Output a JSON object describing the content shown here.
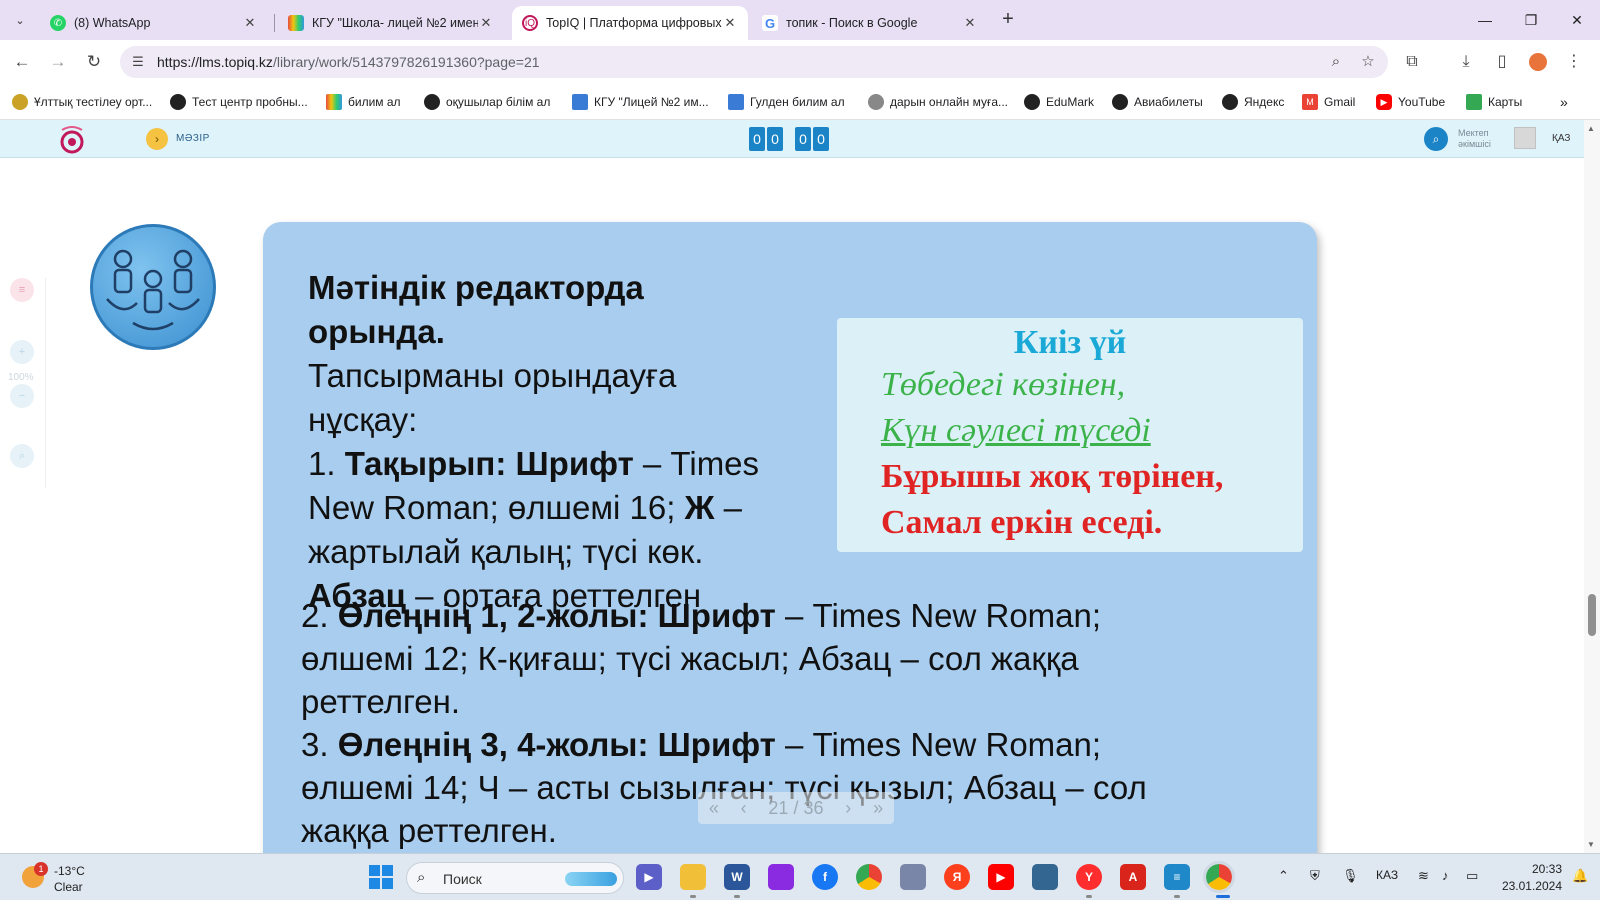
{
  "browser": {
    "tabs": [
      {
        "label": "(8) WhatsApp",
        "active": false
      },
      {
        "label": "КГУ \"Школа- лицей №2 имени",
        "active": false
      },
      {
        "label": "TopIQ | Платформа цифровых",
        "active": true
      },
      {
        "label": "топик - Поиск в Google",
        "active": false
      }
    ],
    "url_host": "https://lms.topiq.kz",
    "url_path": "/library/work/5143797826191360?page=21",
    "bookmarks": [
      "Ұлттық тестілеу орт...",
      "Тест центр пробны...",
      "билим ал",
      "оқушылар білім ал",
      "КГУ \"Лицей №2 им...",
      "Гулден билим ал",
      "дарын онлайн муға...",
      "EduMark",
      "Авиабилеты",
      "Яндекс",
      "Gmail",
      "YouTube",
      "Карты"
    ]
  },
  "site": {
    "menu_label": "МӘЗІР",
    "timer": [
      "0",
      "0",
      "0",
      "0"
    ],
    "role_line1": "Мектеп",
    "role_line2": "әкімшісі",
    "language": "ҚАЗ",
    "zoom": "100%"
  },
  "card": {
    "title_line1": "Мәтіндік редакторда",
    "title_line2": "орында.",
    "intro_line1": "Тапсырманы орындауға",
    "intro_line2": "нұсқау:",
    "step1_num": "1.",
    "step1_bold": "Тақырып: Шрифт",
    "step1_text_a": "– Times",
    "step1_text_b": "New Roman; өлшемі 16;",
    "step1_bold2": "Ж",
    "step1_text_c": "–",
    "step1_text_d": "жартылай қалың; түсі көк.",
    "step1_bold3": "Абзац",
    "step1_text_e": "– ортаға реттелген",
    "step2_num": "2.",
    "step2_bold": "Өлеңнің 1, 2-жолы: Шрифт",
    "step2_text_a": "– Times New Roman;",
    "step2_text_b": "өлшемі 12; К-қиғаш; түсі жасыл; Абзац – сол жаққа",
    "step2_text_c": "реттелген.",
    "step3_num": "3.",
    "step3_bold": "Өлеңнің 3, 4-жолы: Шрифт",
    "step3_text_a": "– Times New Roman;",
    "step3_text_b": "өлшемі 14; Ч – асты сызылған; түсі қызыл; Абзац – сол",
    "step3_text_c": "жаққа реттелген."
  },
  "poem": {
    "title": "Киіз үй",
    "line1": "Төбедегі көзінен,",
    "line2": "Күн сәулесі түседі",
    "line3": "Бұрышы жоқ төрінен,",
    "line4": "Самал еркін еседі.",
    "colors": {
      "title": "#1aa9d6",
      "green": "#3bb34a",
      "red": "#e02424"
    }
  },
  "pager": {
    "current": "21",
    "separator": "/",
    "total": "36"
  },
  "taskbar": {
    "weather_badge": "1",
    "temperature": "-13°C",
    "condition": "Clear",
    "search_placeholder": "Поиск",
    "language": "КАЗ",
    "time": "20:33",
    "date": "23.01.2024"
  }
}
